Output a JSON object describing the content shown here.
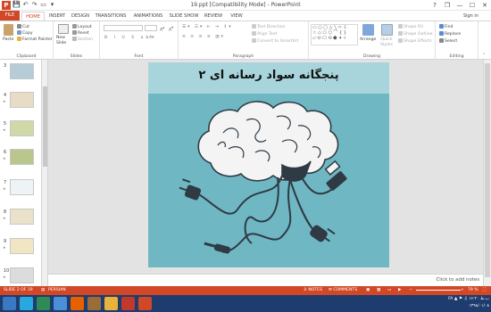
{
  "window": {
    "title": "19.ppt [Compatibility Mode] - PowerPoint",
    "app_logo": "P",
    "controls": [
      "?",
      "❐",
      "—",
      "☐",
      "✕"
    ]
  },
  "tabs": [
    {
      "label": "FILE"
    },
    {
      "label": "HOME"
    },
    {
      "label": "INSERT"
    },
    {
      "label": "DESIGN"
    },
    {
      "label": "TRANSITIONS"
    },
    {
      "label": "ANIMATIONS"
    },
    {
      "label": "SLIDE SHOW"
    },
    {
      "label": "REVIEW"
    },
    {
      "label": "VIEW"
    }
  ],
  "signin": "Sign in",
  "ribbon": {
    "clipboard": {
      "label": "Clipboard",
      "paste": "Paste",
      "cut": "Cut",
      "copy": "Copy",
      "format_painter": "Format Painter"
    },
    "slides": {
      "label": "Slides",
      "new_slide": "New Slide",
      "layout": "Layout",
      "reset": "Reset",
      "section": "Section"
    },
    "font": {
      "label": "Font"
    },
    "paragraph": {
      "label": "Paragraph",
      "text_direction": "Text Direction",
      "align_text": "Align Text",
      "smartart": "Convert to SmartArt"
    },
    "drawing": {
      "label": "Drawing",
      "arrange": "Arrange",
      "quick_styles": "Quick Styles",
      "shape_fill": "Shape Fill",
      "shape_outline": "Shape Outline",
      "shape_effects": "Shape Effects"
    },
    "editing": {
      "label": "Editing",
      "find": "Find",
      "replace": "Replace",
      "select": "Select"
    }
  },
  "thumbnails": [
    {
      "num": "3"
    },
    {
      "num": "4"
    },
    {
      "num": "5"
    },
    {
      "num": "6"
    },
    {
      "num": "7"
    },
    {
      "num": "8"
    },
    {
      "num": "9"
    },
    {
      "num": "10"
    }
  ],
  "slide": {
    "title": "پنجگانه سواد رسانه ای ۲"
  },
  "notes_placeholder": "Click to add notes",
  "status": {
    "slide_of": "SLIDE 2 OF 19",
    "language": "PERSIAN",
    "notes": "NOTES",
    "comments": "COMMENTS",
    "zoom": "79 %"
  },
  "tray": {
    "lang": "FA",
    "time": "۱۶:۲۰ ب.ظ",
    "date": "۱۳۹۸/۰۱/۰۸"
  },
  "colors": {
    "accent": "#d24726",
    "slide_bg": "#6fb8c3",
    "title_band": "#a8d5dc",
    "taskbar": "#1e3c6e"
  }
}
